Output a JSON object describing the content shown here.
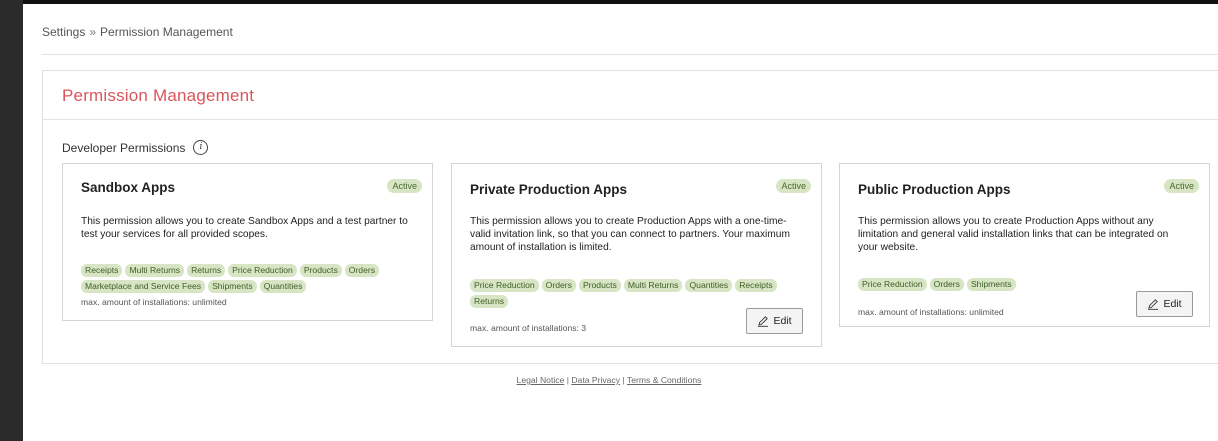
{
  "breadcrumb": {
    "root": "Settings",
    "separator": "»",
    "current": "Permission Management"
  },
  "panel": {
    "title": "Permission Management",
    "section_label": "Developer Permissions"
  },
  "cards": [
    {
      "title": "Sandbox Apps",
      "status": "Active",
      "description": "This permission allows you to create Sandbox Apps and a test partner to test your services for all provided scopes.",
      "tags": [
        "Receipts",
        "Multi Returns",
        "Returns",
        "Price Reduction",
        "Products",
        "Orders",
        "Marketplace and Service Fees",
        "Shipments",
        "Quantities"
      ],
      "max_installations": "max. amount of installations: unlimited"
    },
    {
      "title": "Private Production Apps",
      "status": "Active",
      "description": "This permission allows you to create Production Apps with a one-time-valid invitation link, so that you can connect to partners. Your maximum amount of installation is limited.",
      "tags": [
        "Price Reduction",
        "Orders",
        "Products",
        "Multi Returns",
        "Quantities",
        "Receipts",
        "Returns"
      ],
      "max_installations": "max. amount of installations: 3",
      "edit_label": "Edit"
    },
    {
      "title": "Public Production Apps",
      "status": "Active",
      "description": "This permission allows you to create Production Apps without any limitation and general valid installation links that can be integrated on your website.",
      "tags": [
        "Price Reduction",
        "Orders",
        "Shipments"
      ],
      "max_installations": "max. amount of installations: unlimited",
      "edit_label": "Edit"
    }
  ],
  "footer": {
    "legal": "Legal Notice",
    "privacy": "Data Privacy",
    "terms": "Terms & Conditions",
    "divider": "|"
  },
  "colors": {
    "title_accent": "#d9555b",
    "tag_bg": "#d7e5c5",
    "tag_text": "#3f5d26",
    "sidebar": "#2b2b2b"
  }
}
